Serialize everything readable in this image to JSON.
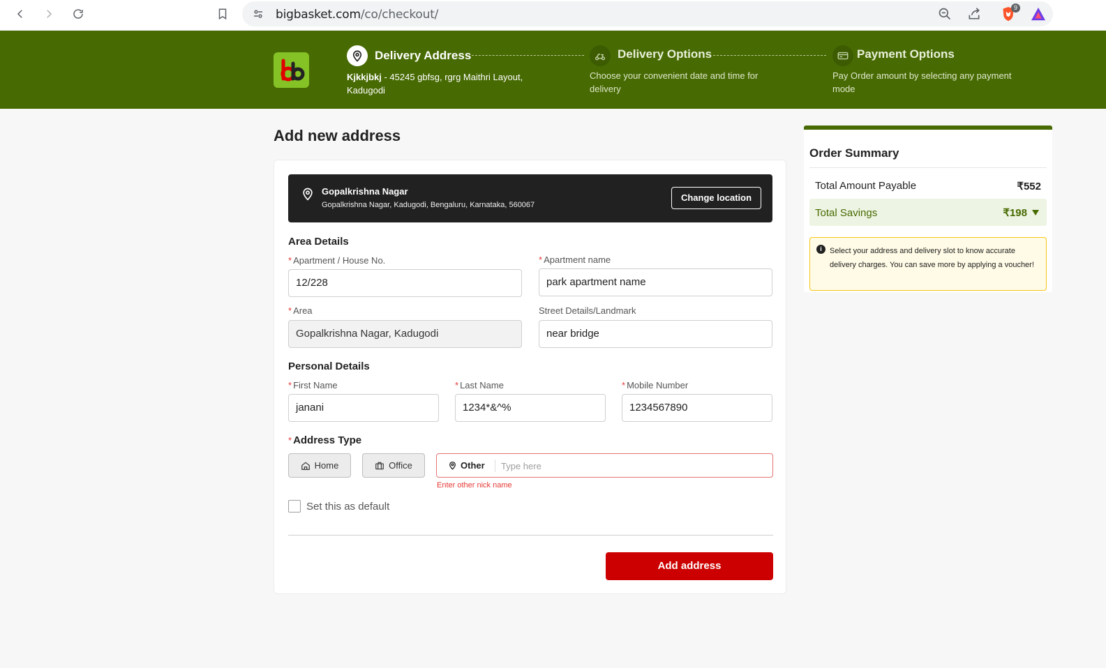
{
  "browser": {
    "url_domain": "bigbasket.com",
    "url_path": "/co/checkout/",
    "extension_badge": "9"
  },
  "header": {
    "logo_alt": "bb",
    "steps": [
      {
        "title": "Delivery Address",
        "desc": "Kjkkjbkj - 45245 gbfsg, rgrg Maithri Layout, Kadugodi",
        "desc_bold": "Kjkkjbkj",
        "desc_rest": " - 45245 gbfsg, rgrg Maithri Layout, Kadugodi"
      },
      {
        "title": "Delivery Options",
        "desc": "Choose your convenient date and time for delivery"
      },
      {
        "title": "Payment Options",
        "desc": "Pay Order amount by selecting any payment mode"
      }
    ]
  },
  "form": {
    "page_title": "Add new address",
    "location": {
      "title": "Gopalkrishna Nagar",
      "subtitle": "Gopalkrishna Nagar, Kadugodi, Bengaluru, Karnataka, 560067",
      "change_label": "Change location"
    },
    "area_section": "Area Details",
    "fields": {
      "house_label": "Apartment / House No.",
      "house_value": "12/228",
      "apt_label": "Apartment name",
      "apt_value": "park apartment name",
      "area_label": "Area",
      "area_value": "Gopalkrishna Nagar, Kadugodi",
      "street_label": "Street Details/Landmark",
      "street_value": "near bridge",
      "first_label": "First Name",
      "first_value": "janani",
      "last_label": "Last Name",
      "last_value": "1234*&^%",
      "mobile_label": "Mobile Number",
      "mobile_value": "1234567890"
    },
    "personal_section": "Personal Details",
    "address_type_label": "Address Type",
    "types": {
      "home": "Home",
      "office": "Office",
      "other": "Other",
      "other_placeholder": "Type here",
      "error": "Enter other nick name"
    },
    "default_label": "Set this as default",
    "submit_label": "Add address"
  },
  "summary": {
    "title": "Order Summary",
    "total_label": "Total Amount Payable",
    "total_value": "₹552",
    "savings_label": "Total Savings",
    "savings_value": "₹198",
    "notice": "Select your address and delivery slot to know accurate delivery charges. You can save more by applying a voucher!"
  },
  "colors": {
    "brand_green": "#476a02",
    "logo_green": "#84c225",
    "accent_red": "#cc0000",
    "error_red": "#e53935",
    "notice_border": "#f5c518"
  }
}
